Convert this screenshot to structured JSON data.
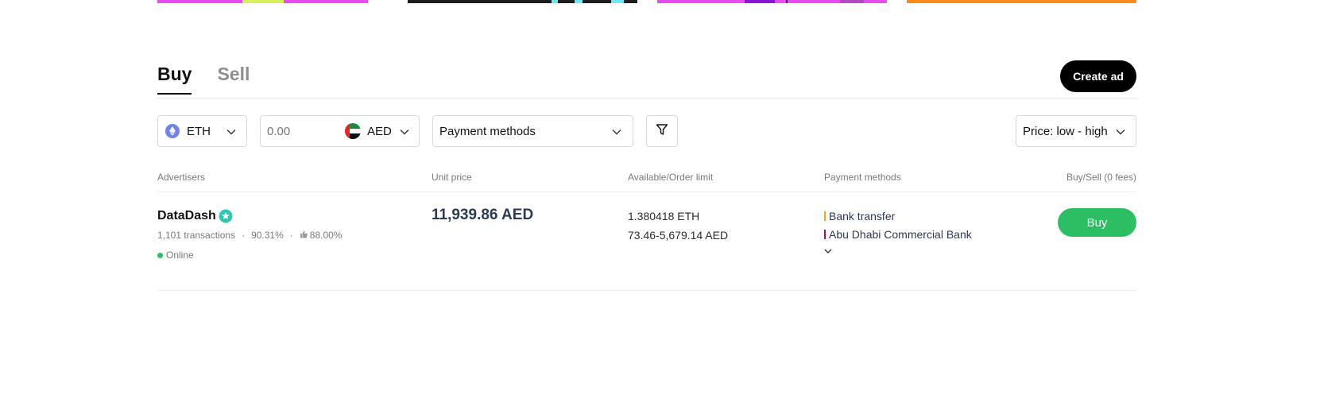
{
  "banners": {
    "colors": [
      "#e84cf2",
      "#1d1d1d",
      "#e84cf2",
      "#ff8c1a"
    ]
  },
  "tabs": [
    {
      "label": "Buy",
      "active": true
    },
    {
      "label": "Sell",
      "active": false
    }
  ],
  "header": {
    "create_ad_label": "Create ad"
  },
  "filters": {
    "crypto": {
      "icon": "ethereum-icon",
      "value": "ETH"
    },
    "amount": {
      "placeholder": "0.00",
      "currency": "AED",
      "currency_icon": "uae-flag-icon"
    },
    "payment_methods": {
      "value": "Payment methods"
    },
    "filter_icon": "filter-icon",
    "sort": {
      "value": "Price: low - high"
    }
  },
  "table": {
    "columns": [
      "Advertisers",
      "Unit price",
      "Available/Order limit",
      "Payment methods",
      "Buy/Sell (0 fees)"
    ],
    "rows": [
      {
        "advertiser": "DataDash",
        "transactions": "1,101 transactions",
        "completion": "90.31%",
        "rating": "88.00%",
        "status": "Online",
        "unit_price": "11,939.86 AED",
        "available": "1.380418 ETH",
        "limit": "73.46-5,679.14 AED",
        "payment_methods": [
          {
            "label": "Bank transfer",
            "color": "#f5a623"
          },
          {
            "label": "Abu Dhabi Commercial Bank",
            "color": "#b0123f"
          }
        ],
        "action_label": "Buy"
      }
    ]
  },
  "colors": {
    "accent_green": "#2dbd63",
    "primary_dark": "#000000"
  }
}
